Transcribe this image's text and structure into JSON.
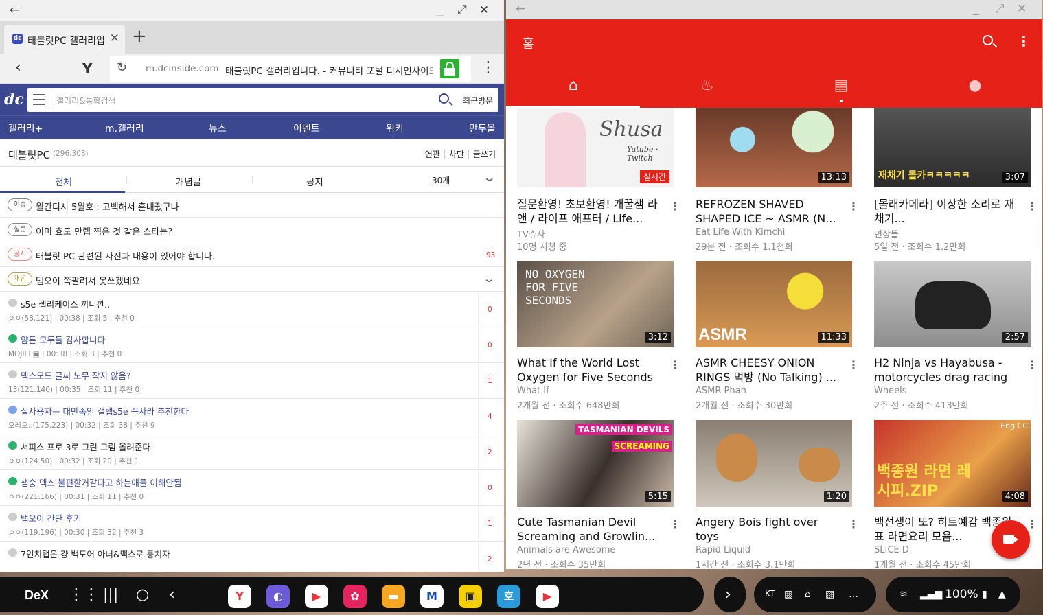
{
  "browser": {
    "tab_title": "태블릿PC 갤러리입니다.",
    "url_domain": "m.dcinside.com",
    "url_title": "태블릿PC 갤러리입니다. - 커뮤니티 포털 디시인사이드",
    "colors": {
      "brand": "#3b4890",
      "lock": "#29b32f"
    }
  },
  "dc": {
    "search_placeholder": "갤러리&통합검색",
    "recent_label": "최근방문",
    "nav": [
      "갤러리+",
      "m.갤러리",
      "뉴스",
      "이벤트",
      "위키",
      "만두몰"
    ],
    "gallery_name": "태블릿PC",
    "gallery_count": "(296,308)",
    "gallery_links": [
      "연관",
      "차단",
      "글쓰기"
    ],
    "subtabs": [
      "전체",
      "개념글",
      "공지",
      "30개"
    ],
    "notices": [
      {
        "badge": "이슈",
        "text": "월간디시 5월호 : 고백해서 혼내줬구나",
        "count": ""
      },
      {
        "badge": "설문",
        "text": "이미 효도 만렙 찍은 것 같은 스타는?",
        "count": ""
      },
      {
        "badge": "공지",
        "text": "태블릿 PC 관련된 사진과 내용이 있어야 합니다.",
        "count": "93"
      },
      {
        "badge": "개념",
        "text": "탭오이 쪽팔려서 못쓰겠네요",
        "count": ""
      }
    ],
    "posts": [
      {
        "title": "s5e 젤리케이스 끼니깐..",
        "meta": "ㅇㅇ(58.121) | 00:38 | 조회 5 | 추천 0",
        "count": "0",
        "icon": "gray"
      },
      {
        "title": "얌튼 모두들 감사합니다",
        "meta": "MOJILI ▣ | 00:38 | 조회 3 | 추천 0",
        "count": "0",
        "icon": "green"
      },
      {
        "title": "덱스모드 글씨 노무 작지 않음?",
        "meta": "13(121.140) | 00:35 | 조회 11 | 추천 0",
        "count": "1",
        "icon": "gray"
      },
      {
        "title": "실사용자는 대만족인 갤탭s5e 꼭사라 추천한다",
        "meta": "오레오..(175.223) | 00:32 | 조회 38 | 추천 9",
        "count": "4",
        "icon": "blue"
      },
      {
        "title": "서피스 프로 3로 그린 그림 올려준다",
        "meta": "ㅇㅇ(124.50) | 00:32 | 조회 20 | 추천 1",
        "count": "2",
        "icon": "green"
      },
      {
        "title": "샘숭 덱스 불편할거같다고 하는애들 이해안됨",
        "meta": "ㅇㅇ(221.166) | 00:31 | 조회 11 | 추천 0",
        "count": "0",
        "icon": "green"
      },
      {
        "title": "탭오이 간단 후기",
        "meta": "ㅇㅇ(119.196) | 00:30 | 조회 32 | 추천 3",
        "count": "1",
        "icon": "gray"
      },
      {
        "title": "7인치탭은 걍 백도어 아너&맥스로 퉁치자",
        "meta": "",
        "count": "2",
        "icon": "gray"
      }
    ]
  },
  "youtube": {
    "header_title": "홈",
    "accent": "#e62117",
    "videos": [
      {
        "title": "질문환영! 초보환영! 개꿀잼 라앤 / 라이프 애프터 / Life...",
        "channel": "TV슈사",
        "meta": "10명 시청 중",
        "badge": "실시간",
        "thumb_text": "Shusa",
        "thumb_sub": "Yutube · Twitch"
      },
      {
        "title": "REFROZEN SHAVED SHAPED ICE ~ ASMR (N...",
        "channel": "Eat Life With Kimchi",
        "meta": "29분 전 · 조회수 1.1천회",
        "duration": "13:13"
      },
      {
        "title": "[몰래카메라] 이상한 소리로 재채기...",
        "channel": "면상들",
        "meta": "5일 전 · 조회수 1.2만회",
        "duration": "3:07",
        "thumb_text": "재채기 몰카ㅋㅋㅋㅋㅋ"
      },
      {
        "title": "What If the World Lost Oxygen for Five Seconds",
        "channel": "What If",
        "meta": "2개월 전 · 조회수 648만회",
        "duration": "3:12",
        "thumb_text": "NO OXYGEN FOR FIVE SECONDS"
      },
      {
        "title": "ASMR CHEESY ONION RINGS 먹방 (No Talking) ...",
        "channel": "ASMR Phan",
        "meta": "2개월 전 · 조회수 30만회",
        "duration": "11:33",
        "thumb_text": "ASMR"
      },
      {
        "title": "H2 Ninja vs Hayabusa - motorcycles drag racing",
        "channel": "Wheels",
        "meta": "2주 전 · 조회수 413만회",
        "duration": "2:57"
      },
      {
        "title": "Cute Tasmanian Devil Screaming and Growlin...",
        "channel": "Animals are Awesome",
        "meta": "2년 전 · 조회수 35만회",
        "duration": "5:15",
        "thumb_text": "TASMANIAN DEVILS",
        "thumb_sub": "SCREAMING"
      },
      {
        "title": "Angery Bois fight over toys",
        "channel": "Rapid Liquid",
        "meta": "1시간 전 · 조회수 3.1만회",
        "duration": "1:20"
      },
      {
        "title": "백선생이 또? 히트예감 백종원표 라면요리 모음...",
        "channel": "SLICE D",
        "meta": "1개월 전 · 조회수 45만회",
        "duration": "4:08",
        "thumb_text": "백종원 라면 레시피.ZIP",
        "thumb_sub": "Eng CC"
      }
    ]
  },
  "taskbar": {
    "dex_label": "DeX",
    "status_label": "KT",
    "battery": "100%"
  }
}
